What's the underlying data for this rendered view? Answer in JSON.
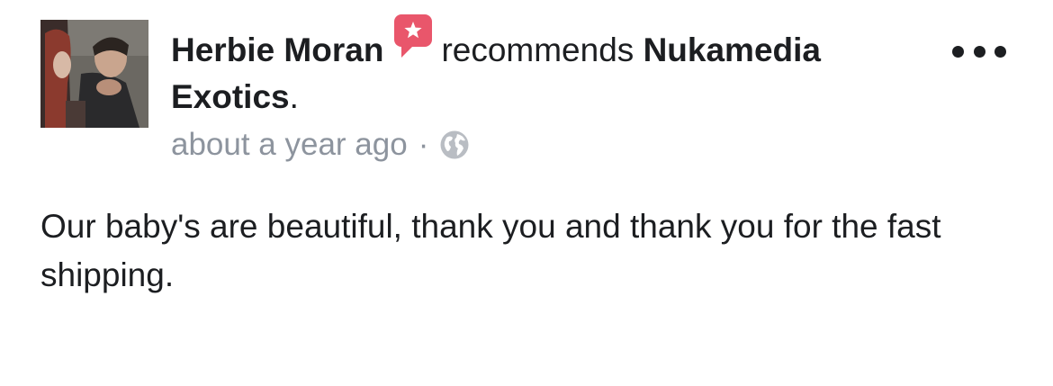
{
  "post": {
    "author": "Herbie Moran",
    "action": "recommends",
    "page_name": "Nukamedia Exotics",
    "punctuation": ".",
    "timestamp": "about a year ago",
    "separator": "·",
    "audience_icon": "globe-icon",
    "recommend_icon": "recommend-star-icon",
    "more_icon": "more-options-icon",
    "text": "Our baby's are beautiful, thank you and thank you for the fast shipping."
  },
  "colors": {
    "recommend_badge": "#e9566b",
    "meta_gray": "#8d949e",
    "text": "#1c1e21"
  }
}
